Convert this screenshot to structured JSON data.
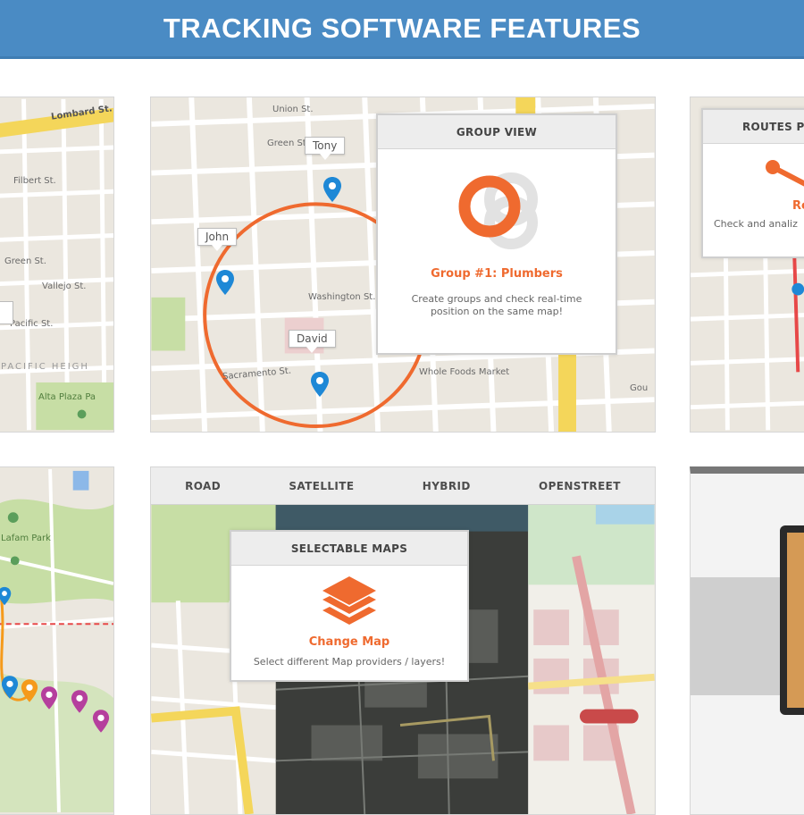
{
  "banner": {
    "title": "TRACKING SOFTWARE FEATURES"
  },
  "tiles": {
    "top_left": {
      "streets": [
        "Lombard St.",
        "Filbert St.",
        "Green St.",
        "Vallejo St.",
        "Pacific St.",
        "PACIFIC HEIGH",
        "Alta Plaza Pa"
      ]
    },
    "group_view": {
      "streets": [
        "Union St.",
        "Green St.",
        "Washington St.",
        "Sacramento St.",
        "Whole Foods Market",
        "Gou"
      ],
      "markers": [
        "Tony",
        "John",
        "David"
      ],
      "popup": {
        "title": "GROUP VIEW",
        "subtitle": "Group #1: Plumbers",
        "description_line1": "Create groups and check real-time",
        "description_line2": "position on the same map!"
      }
    },
    "routes": {
      "popup": {
        "title": "ROUTES P",
        "subtitle": "Ro",
        "description": "Check and analiz"
      }
    },
    "bottom_left": {
      "streets": [
        "Lafam Park"
      ]
    },
    "selectable_maps": {
      "tabs": [
        "ROAD",
        "SATELLITE",
        "HYBRID",
        "OPENSTREET"
      ],
      "popup": {
        "title": "SELECTABLE MAPS",
        "subtitle": "Change Map",
        "description": "Select different Map providers / layers!"
      }
    }
  },
  "colors": {
    "banner": "#4a8bc4",
    "accent": "#ef6a2f",
    "marker_blue": "#1e88d6",
    "marker_orange": "#f59a1b",
    "marker_purple": "#b53f9d"
  }
}
